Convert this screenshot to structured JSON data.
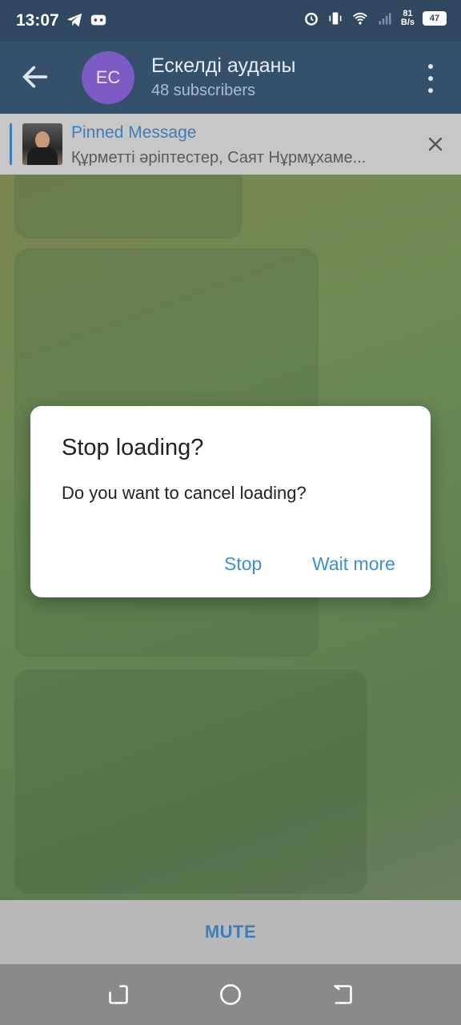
{
  "status_bar": {
    "time": "13:07",
    "net_speed_value": "81",
    "net_speed_unit": "B/s",
    "battery": "47",
    "icons": [
      "telegram-icon",
      "game-icon",
      "alarm-icon",
      "vibrate-icon",
      "wifi-icon",
      "signal-icon",
      "battery-icon"
    ]
  },
  "header": {
    "avatar_initials": "EC",
    "title": "Ескелді ауданы",
    "subtitle": "48 subscribers"
  },
  "pinned": {
    "label": "Pinned Message",
    "text": "Құрметті әріптестер, Саят Нұрмұхаме..."
  },
  "dialog": {
    "title": "Stop loading?",
    "message": "Do you want to cancel loading?",
    "stop_label": "Stop",
    "wait_label": "Wait more"
  },
  "bottom": {
    "mute_label": "MUTE"
  },
  "colors": {
    "header": "#34506b",
    "accent": "#3d7db8",
    "dialog_button": "#3d8fd1"
  }
}
